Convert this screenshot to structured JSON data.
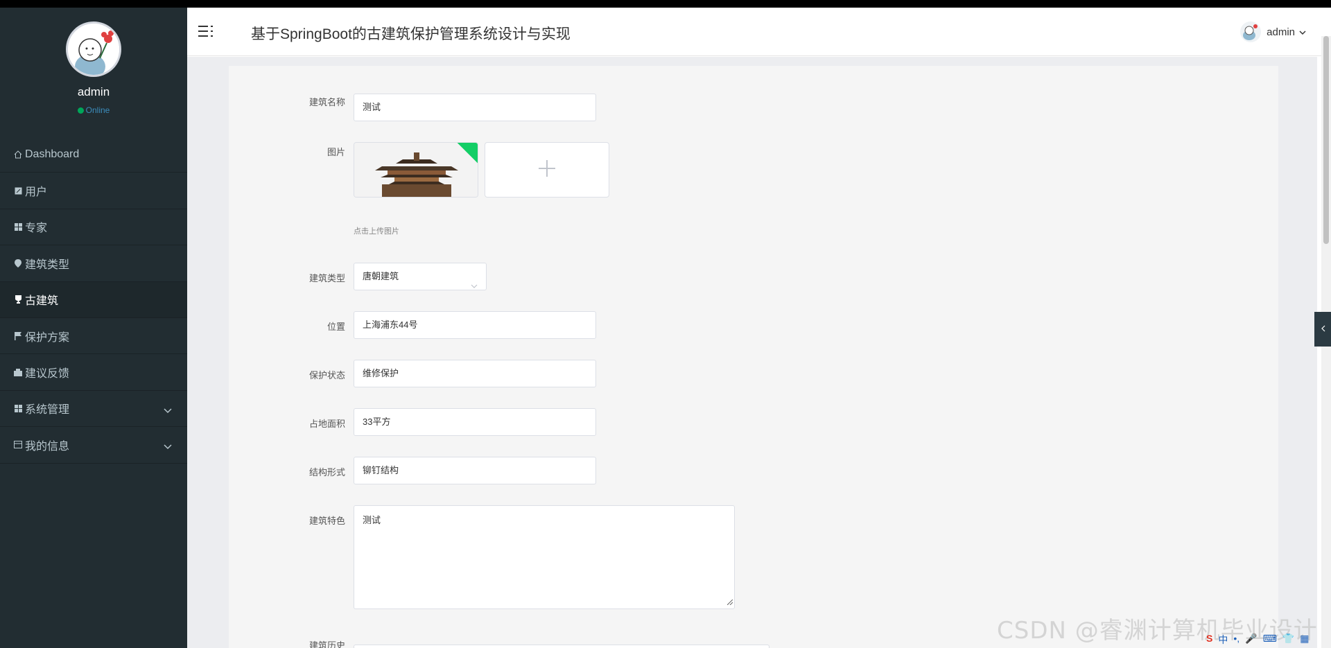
{
  "sidebar": {
    "username": "admin",
    "status": "Online",
    "items": [
      {
        "label": "Dashboard",
        "icon": "home-icon"
      },
      {
        "label": "用户",
        "icon": "edit-icon"
      },
      {
        "label": "专家",
        "icon": "grid-icon"
      },
      {
        "label": "建筑类型",
        "icon": "pin-icon"
      },
      {
        "label": "古建筑",
        "icon": "trophy-icon",
        "active": true
      },
      {
        "label": "保护方案",
        "icon": "flag-icon"
      },
      {
        "label": "建议反馈",
        "icon": "chat-icon"
      },
      {
        "label": "系统管理",
        "icon": "grid-icon",
        "expandable": true
      },
      {
        "label": "我的信息",
        "icon": "card-icon",
        "expandable": true
      }
    ]
  },
  "header": {
    "title": "基于SpringBoot的古建筑保护管理系统设计与实现",
    "user": "admin"
  },
  "form": {
    "name_label": "建筑名称",
    "name_value": "测试",
    "image_label": "图片",
    "upload_hint": "点击上传图片",
    "type_label": "建筑类型",
    "type_value": "唐朝建筑",
    "location_label": "位置",
    "location_value": "上海浦东44号",
    "protect_label": "保护状态",
    "protect_value": "维修保护",
    "area_label": "占地面积",
    "area_value": "33平方",
    "structure_label": "结构形式",
    "structure_value": "铆钉结构",
    "feature_label": "建筑特色",
    "feature_value": "测试",
    "history_label": "建筑历史"
  },
  "watermark": "CSDN @睿渊计算机毕业设计",
  "ime": [
    "S",
    "中",
    "•,",
    "🎤",
    "⌨",
    "👕",
    "▦"
  ],
  "colors": {
    "sidebar": "#222d32",
    "accent": "#3c8dbc",
    "online": "#00a65a",
    "badge": "#13ce66"
  }
}
